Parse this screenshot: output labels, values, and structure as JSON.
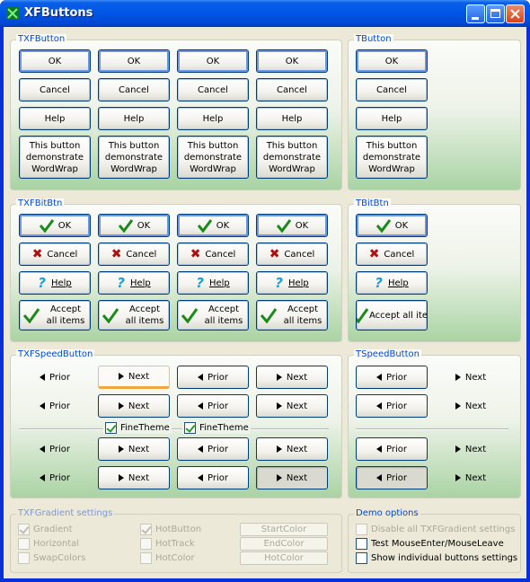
{
  "window": {
    "title": "XFButtons"
  },
  "groups": {
    "txfbutton": "TXFButton",
    "tbutton": "TButton",
    "txfbitbtn": "TXFBitBtn",
    "tbitbtn": "TBitBtn",
    "txfspeedbutton": "TXFSpeedButton",
    "tspeedbutton": "TSpeedButton",
    "gradient_settings": "TXFGradient settings",
    "demo_options": "Demo options"
  },
  "buttons": {
    "ok": "OK",
    "cancel": "Cancel",
    "help": "Help",
    "wordwrap": "This button demonstrate WordWrap",
    "accept_all": "Accept all items",
    "accept_all_item": "Accept all item"
  },
  "speed": {
    "prior": "Prior",
    "next": "Next",
    "fine_theme": "FineTheme"
  },
  "gradient": {
    "gradient": "Gradient",
    "horizontal": "Horizontal",
    "swapcolors": "SwapColors",
    "hotbutton": "HotButton",
    "hottrack": "HotTrack",
    "hotcolor_check": "HotColor",
    "startcolor": "StartColor",
    "endcolor": "EndColor",
    "hotcolor_btn": "HotColor"
  },
  "options": {
    "disable_all": "Disable all TXFGradient settings",
    "test_mouse": "Test MouseEnter/MouseLeave",
    "show_individual": "Show individual buttons settings"
  },
  "colors": {
    "titlebar": "#0055e5",
    "group_title": "#0046d5",
    "gradient_end": "#a9d3a3",
    "check": "#21a121",
    "cancel_x": "#b01010",
    "help_q": "#1aa0d8"
  }
}
